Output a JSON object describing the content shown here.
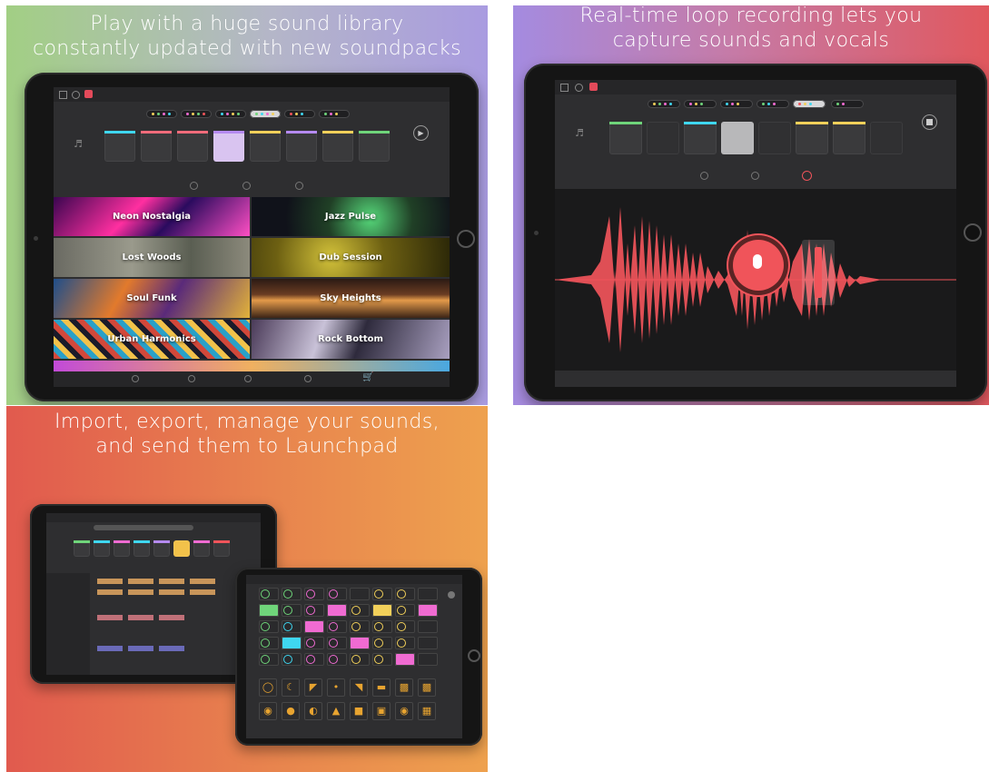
{
  "captions": {
    "library": [
      "Play with a huge sound library",
      "constantly updated with new soundpacks"
    ],
    "recording": [
      "Real-time loop recording lets you",
      "capture sounds and vocals"
    ],
    "import": [
      "Import, export, manage your sounds,",
      "and send them to Launchpad"
    ]
  },
  "library_tiles": [
    "Neon Nostalgia",
    "Jazz Pulse",
    "Lost Woods",
    "Dub Session",
    "Soul Funk",
    "Sky Heights",
    "Urban Harmonics",
    "Rock Bottom"
  ],
  "colors": {
    "accent_red": "#f0545a",
    "pad_green": "#6fd57a",
    "pad_yellow": "#f2d05a",
    "pad_pink": "#f06bd2",
    "pad_cyan": "#3fd7f0",
    "launchpad_orange": "#e8a430"
  },
  "icons": [
    "home-icon",
    "gear-icon",
    "logo-icon",
    "speaker-icon",
    "play-icon",
    "stop-icon",
    "mic-icon",
    "cart-icon"
  ]
}
